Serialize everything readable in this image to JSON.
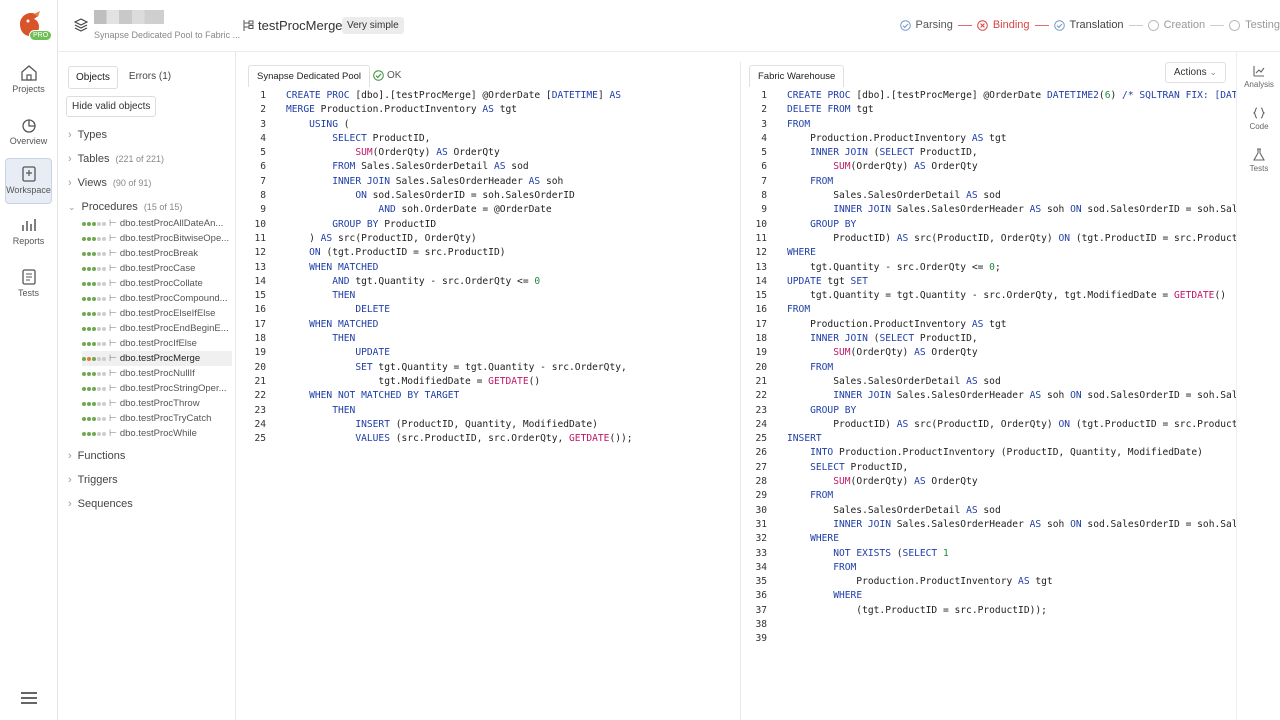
{
  "nav": {
    "items": [
      {
        "label": "Projects",
        "icon": "home-icon"
      },
      {
        "label": "Overview",
        "icon": "overview-icon"
      },
      {
        "label": "Workspace",
        "icon": "workspace-icon"
      },
      {
        "label": "Reports",
        "icon": "reports-icon"
      },
      {
        "label": "Tests",
        "icon": "tests-icon"
      }
    ],
    "pro_label": "PRO",
    "active": "Workspace"
  },
  "header": {
    "project_subtitle": "Synapse Dedicated Pool to Fabric ...",
    "proc_name": "testProcMerge",
    "complexity": "Very simple",
    "steps": [
      {
        "label": "Parsing",
        "state": "done"
      },
      {
        "label": "Binding",
        "state": "error"
      },
      {
        "label": "Translation",
        "state": "done"
      },
      {
        "label": "Creation",
        "state": "pending"
      },
      {
        "label": "Testing",
        "state": "pending"
      }
    ]
  },
  "left": {
    "tab_objects": "Objects",
    "tab_errors": "Errors (1)",
    "hide_button": "Hide valid objects",
    "types": "Types",
    "tables": "Tables",
    "tables_count": "(221 of 221)",
    "views": "Views",
    "views_count": "(90 of 91)",
    "procedures": "Procedures",
    "procedures_count": "(15 of 15)",
    "proc_items": [
      "dbo.testProcAllDateAn...",
      "dbo.testProcBitwiseOpe...",
      "dbo.testProcBreak",
      "dbo.testProcCase",
      "dbo.testProcCollate",
      "dbo.testProcCompound...",
      "dbo.testProcElseIfElse",
      "dbo.testProcEndBeginE...",
      "dbo.testProcIfElse",
      "dbo.testProcMerge",
      "dbo.testProcNullIf",
      "dbo.testProcStringOper...",
      "dbo.testProcThrow",
      "dbo.testProcTryCatch",
      "dbo.testProcWhile"
    ],
    "functions": "Functions",
    "triggers": "Triggers",
    "sequences": "Sequences"
  },
  "source": {
    "tab": "Synapse Dedicated Pool",
    "status": "OK"
  },
  "target": {
    "tab": "Fabric Warehouse",
    "actions": "Actions"
  },
  "rail": {
    "items": [
      "Analysis",
      "Code",
      "Tests"
    ]
  },
  "colors": {
    "keyword": "#1f3ea8",
    "func": "#c0166a",
    "number": "#1a8c3a",
    "gray": "#888888",
    "error": "#d64545",
    "ok": "#3a8f3a"
  }
}
